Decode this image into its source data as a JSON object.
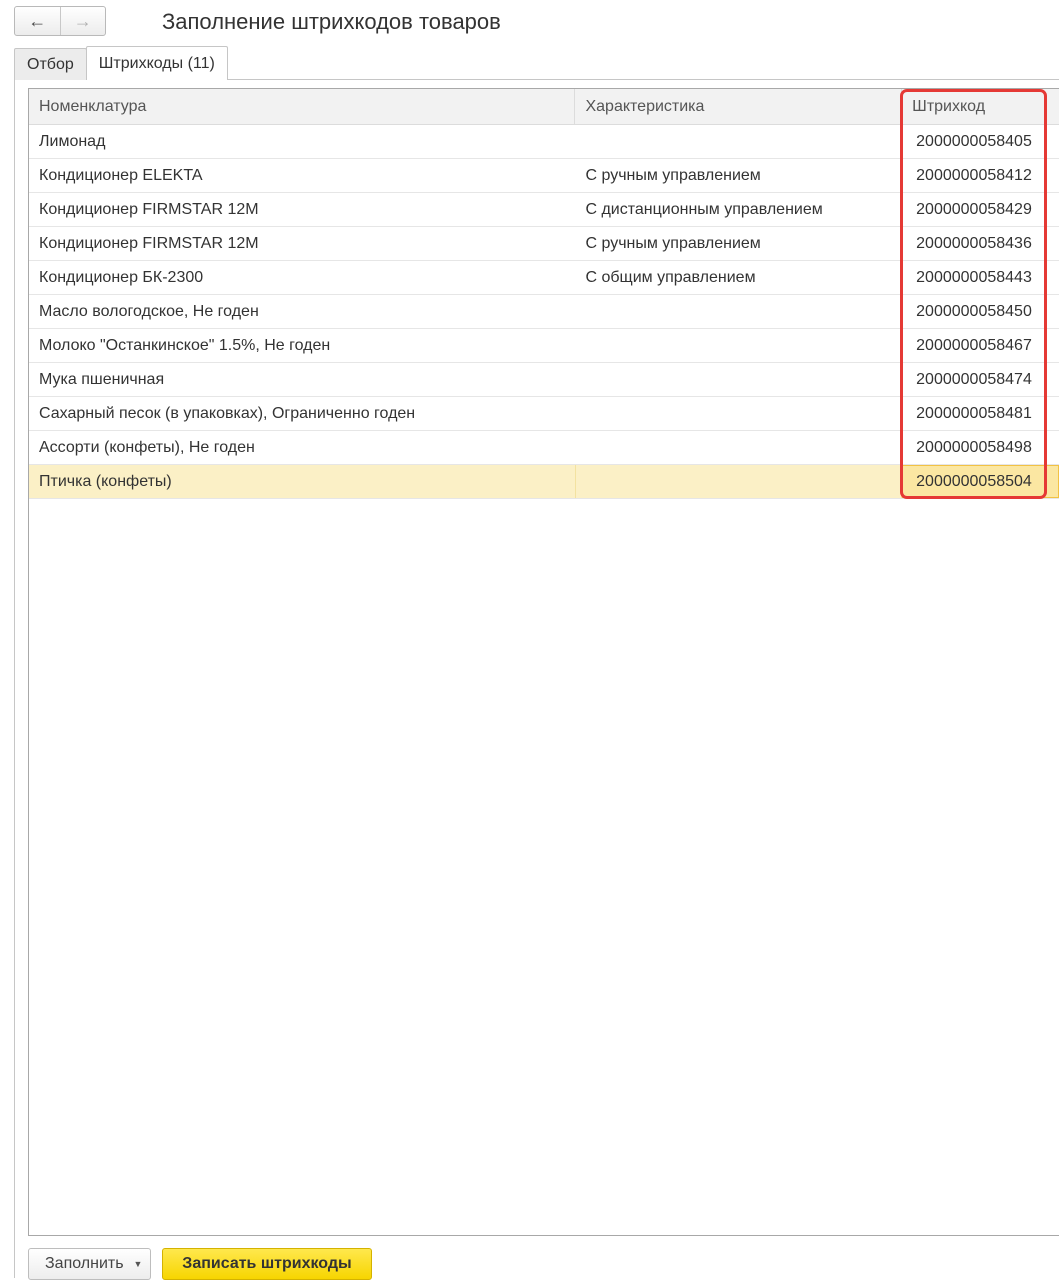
{
  "header": {
    "title": "Заполнение штрихкодов товаров",
    "back_icon": "←",
    "forward_icon": "→"
  },
  "tabs": [
    {
      "label": "Отбор",
      "active": false
    },
    {
      "label": "Штрихкоды (11)",
      "active": true
    }
  ],
  "table": {
    "columns": [
      "Номенклатура",
      "Характеристика",
      "Штрихкод"
    ],
    "rows": [
      {
        "nomenclature": "Лимонад",
        "characteristic": "",
        "barcode": "2000000058405"
      },
      {
        "nomenclature": "Кондиционер ELEKTA",
        "characteristic": "С ручным управлением",
        "barcode": "2000000058412"
      },
      {
        "nomenclature": "Кондиционер FIRMSTAR 12M",
        "characteristic": "С дистанционным управлением",
        "barcode": "2000000058429"
      },
      {
        "nomenclature": "Кондиционер FIRMSTAR 12M",
        "characteristic": "С ручным управлением",
        "barcode": "2000000058436"
      },
      {
        "nomenclature": "Кондиционер БК-2300",
        "characteristic": "С общим управлением",
        "barcode": "2000000058443"
      },
      {
        "nomenclature": "Масло вологодское, Не годен",
        "characteristic": "",
        "barcode": "2000000058450"
      },
      {
        "nomenclature": "Молоко \"Останкинское\" 1.5%, Не годен",
        "characteristic": "",
        "barcode": "2000000058467"
      },
      {
        "nomenclature": "Мука пшеничная",
        "characteristic": "",
        "barcode": "2000000058474"
      },
      {
        "nomenclature": "Сахарный песок (в упаковках), Ограниченно годен",
        "characteristic": "",
        "barcode": "2000000058481"
      },
      {
        "nomenclature": "Ассорти (конфеты), Не годен",
        "characteristic": "",
        "barcode": "2000000058498"
      },
      {
        "nomenclature": "Птичка (конфеты)",
        "characteristic": "",
        "barcode": "2000000058504",
        "selected": true
      }
    ]
  },
  "footer": {
    "fill_label": "Заполнить",
    "dropdown_icon": "▼",
    "save_label": "Записать штрихкоды"
  },
  "colors": {
    "highlight": "#e53935",
    "selected_row": "#fbf0c6",
    "primary_button": "#f7d500"
  }
}
